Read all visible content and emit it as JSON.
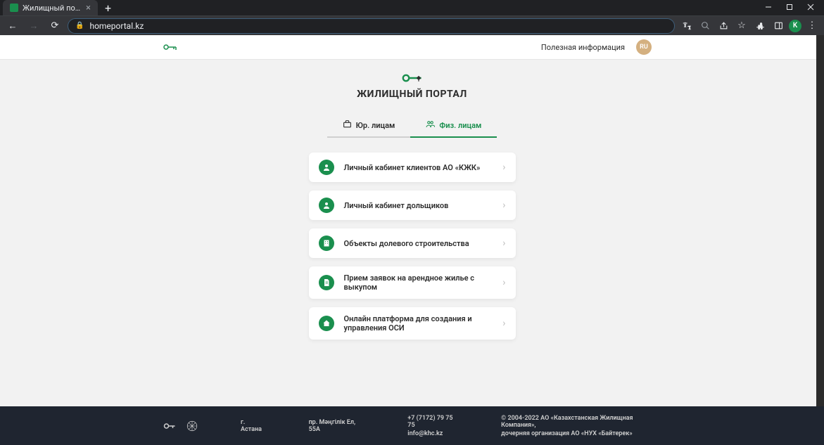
{
  "browser": {
    "tab_title": "Жилищный портал АО \"КЖК\"",
    "url": "homeportal.kz",
    "profile_letter": "K"
  },
  "header": {
    "info_link": "Полезная информация",
    "lang": "RU"
  },
  "hero": {
    "title": "ЖИЛИЩНЫЙ ПОРТАЛ"
  },
  "tabs": {
    "legal": "Юр. лицам",
    "individual": "Физ. лицам"
  },
  "cards": [
    {
      "label": "Личный кабинет клиентов АО «КЖК»"
    },
    {
      "label": "Личный кабинет дольщиков"
    },
    {
      "label": "Объекты долевого строительства"
    },
    {
      "label": "Прием заявок на арендное жилье с выкупом"
    },
    {
      "label": "Онлайн платформа для создания и управления ОСИ"
    }
  ],
  "footer": {
    "city": "г. Астана",
    "address": "пр. Мәңгілік Ел, 55А",
    "phone": "+7 (7172) 79 75 75",
    "email": "info@khc.kz",
    "copyright1": "© 2004-2022 АО «Казахстанская Жилищная Компания»,",
    "copyright2": "дочерняя организация АО «НУХ «Байтерек»"
  }
}
